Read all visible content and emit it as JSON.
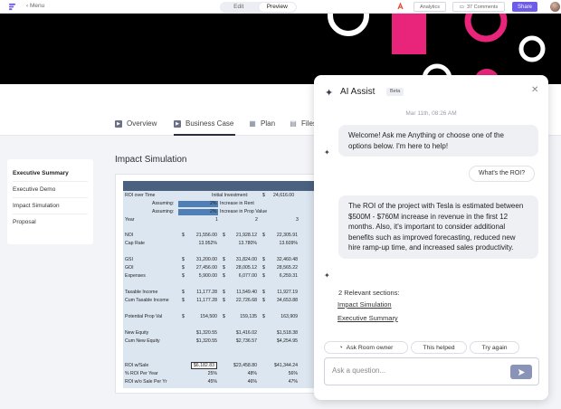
{
  "topbar": {
    "menu_label": "Menu",
    "tabs": [
      "Edit",
      "Preview"
    ],
    "active_tab": "Preview",
    "analytics_label": "Analytics",
    "comments_label": "37 Comments",
    "share_label": "Share"
  },
  "nav": {
    "items": [
      {
        "label": "Overview",
        "icon": "play-icon"
      },
      {
        "label": "Business Case",
        "icon": "play-icon"
      },
      {
        "label": "Plan",
        "icon": "calendar-icon"
      },
      {
        "label": "Files",
        "icon": "file-icon"
      }
    ],
    "active": "Business Case"
  },
  "sidebar": {
    "items": [
      {
        "label": "Executive Summary",
        "active": true
      },
      {
        "label": "Executive Demo",
        "active": false
      },
      {
        "label": "Impact Simulation",
        "active": false
      },
      {
        "label": "Proposal",
        "active": false
      }
    ]
  },
  "main": {
    "section_title": "Impact Simulation"
  },
  "sheet": {
    "roi_label": "ROI over Time",
    "initial_investment_label": "Initial Investment:",
    "initial_investment_value": "24,616.00",
    "assuming1": "Assuming:",
    "assuming1_pct": "2%",
    "assuming1_text": "Increase in Rent",
    "assuming2": "Assuming:",
    "assuming2_pct": "2%",
    "assuming2_text": "Increase in Prop Value",
    "year_label": "Year",
    "year1": "1",
    "year2": "2",
    "year3": "3",
    "rows": [
      {
        "label": "NOI",
        "c1": "21,556.00",
        "c2": "21,928.12",
        "c3": "22,305.91",
        "dollar": true
      },
      {
        "label": "Cap Rate",
        "c1": "13.952%",
        "c2": "13.780%",
        "c3": "13.609%",
        "dollar": false
      },
      {
        "label": "GSI",
        "c1": "31,200.00",
        "c2": "31,824.00",
        "c3": "32,460.48",
        "dollar": true
      },
      {
        "label": "GOI",
        "c1": "27,456.00",
        "c2": "28,005.12",
        "c3": "28,565.22",
        "dollar": true
      },
      {
        "label": "Expenses",
        "c1": "5,900.00",
        "c2": "6,077.00",
        "c3": "6,259.31",
        "dollar": true
      },
      {
        "label": "Taxable Income",
        "c1": "11,177.28",
        "c2": "11,549.40",
        "c3": "11,927.19",
        "dollar": true
      },
      {
        "label": "Cum Taxable Income",
        "c1": "11,177.28",
        "c2": "22,726.68",
        "c3": "34,653.88",
        "dollar": true
      },
      {
        "label": "Potential Prop Val",
        "c1": "154,500",
        "c2": "159,135",
        "c3": "163,909",
        "dollar": true
      },
      {
        "label": "New Equity",
        "c1": "$1,320.55",
        "c2": "$1,416.02",
        "c3": "$1,518.38",
        "dollar": false
      },
      {
        "label": "Cum New Equity",
        "c1": "$1,320.55",
        "c2": "$2,736.57",
        "c3": "$4,254.95",
        "dollar": false
      },
      {
        "label": "ROI w/Sale",
        "c1": "$6,182.83",
        "c2": "$23,458.80",
        "c3": "$41,344.24",
        "dollar": false
      },
      {
        "label": "% ROI Per Year",
        "c1": "25%",
        "c2": "48%",
        "c3": "56%",
        "dollar": false
      },
      {
        "label": "ROI w/o Sale Per Yr",
        "c1": "45%",
        "c2": "46%",
        "c3": "47%",
        "dollar": false
      }
    ]
  },
  "ai": {
    "title": "AI Assist",
    "badge": "Beta",
    "date": "Mar 11th, 08:26 AM",
    "welcome": "Welcome! Ask me Anything or choose one of the options below. I'm here to help!",
    "user_question": "What's the ROI?",
    "answer": "The ROI of the project with Tesla is estimated between $500M - $760M increase in revenue in the first 12 months. Also, it's important to consider additional benefits such as improved forecasting, reduced new hire ramp-up time, and increased sales productivity.",
    "relevant_count": "2  Relevant sections:",
    "relevant_links": [
      "Impact Simulation",
      "Executive Summary"
    ],
    "chips": [
      "Ask Room owner",
      "This helped",
      "Try again"
    ],
    "input_placeholder": "Ask a question..."
  },
  "colors": {
    "accent": "#6c5ce7",
    "pink": "#e8257a",
    "hero_bg": "#000000",
    "sheet_header": "#4a6180",
    "sheet_body": "#dce6f0"
  }
}
